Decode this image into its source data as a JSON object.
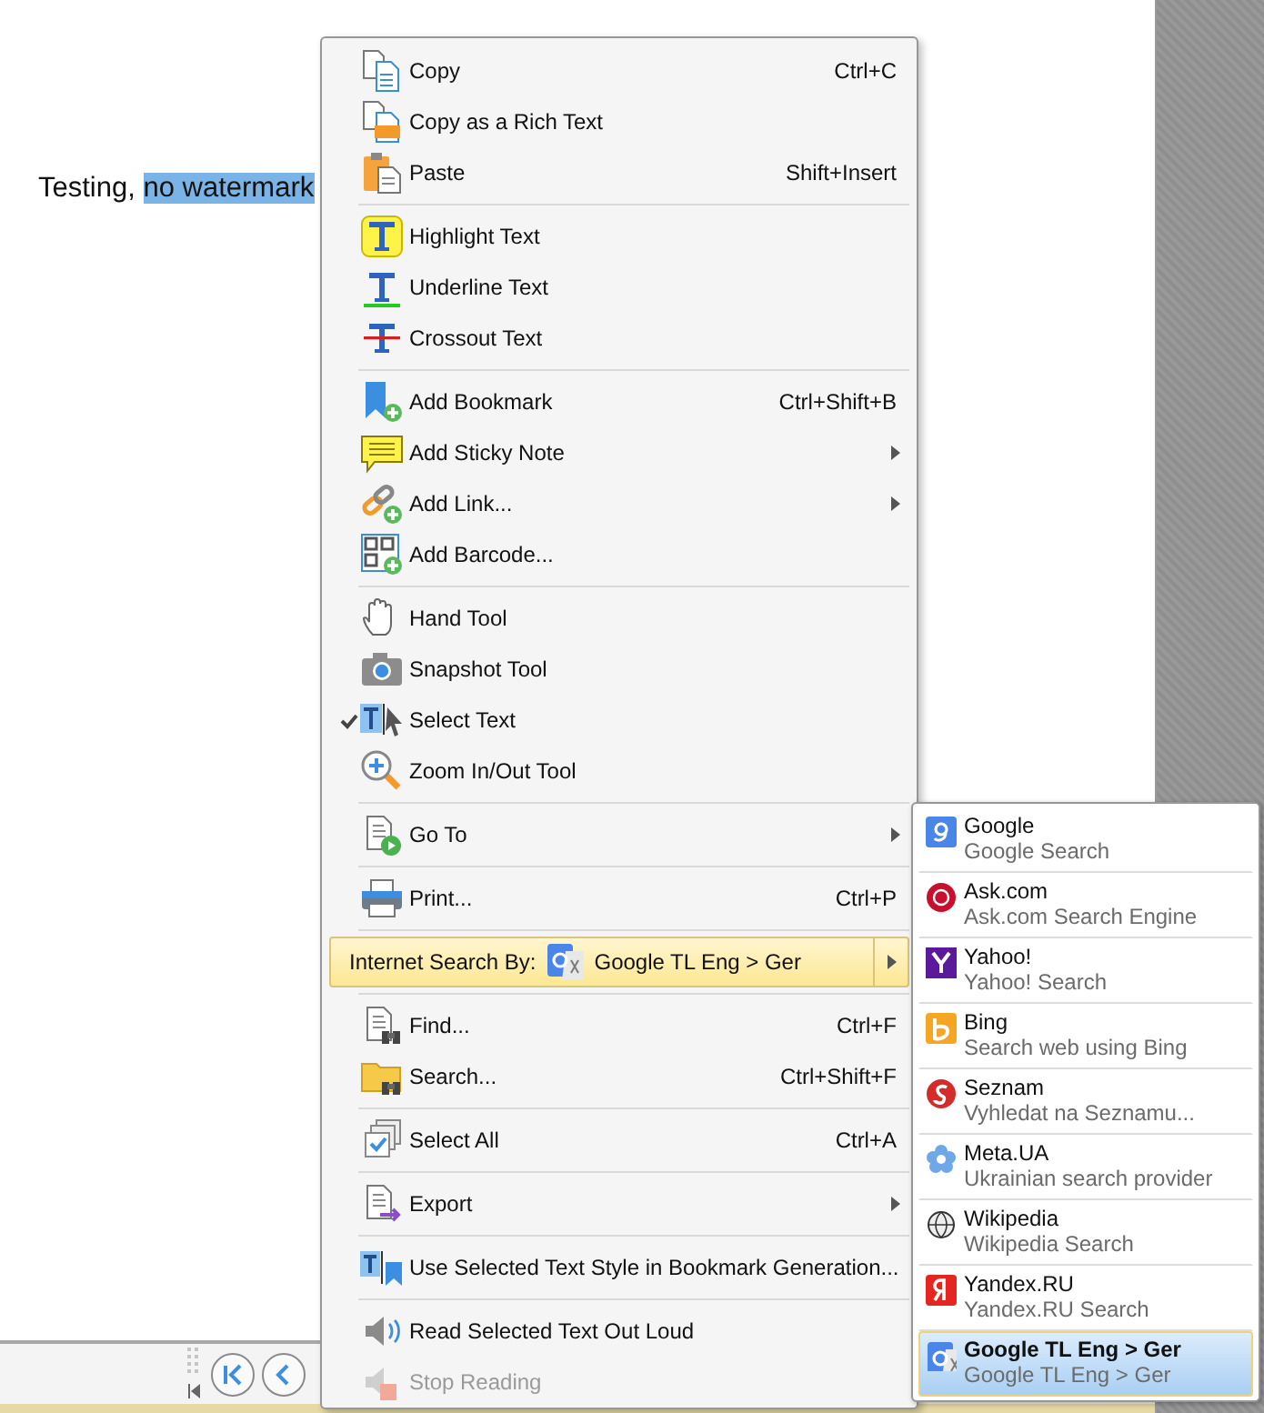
{
  "document": {
    "parts": [
      {
        "text": "Testing, ",
        "selected": false
      },
      {
        "text": "no watermark",
        "selected": true
      }
    ]
  },
  "toolbar": {
    "buttons": [
      {
        "kind": "first-page"
      },
      {
        "kind": "previous-page"
      }
    ]
  },
  "context_menu": {
    "groups": [
      [
        {
          "label": "Copy",
          "shortcut": "Ctrl+C",
          "submenu": false,
          "checked": false,
          "disabled": false,
          "selected": false
        },
        {
          "label": "Copy as a Rich Text",
          "submenu": false,
          "checked": false,
          "disabled": false,
          "selected": false
        },
        {
          "label": "Paste",
          "shortcut": "Shift+Insert",
          "submenu": false,
          "checked": false,
          "disabled": false,
          "selected": false
        }
      ],
      [
        {
          "label": "Highlight Text",
          "submenu": false,
          "checked": false,
          "disabled": false,
          "selected": false
        },
        {
          "label": "Underline Text",
          "submenu": false,
          "checked": false,
          "disabled": false,
          "selected": false
        },
        {
          "label": "Crossout Text",
          "submenu": false,
          "checked": false,
          "disabled": false,
          "selected": false
        }
      ],
      [
        {
          "label": "Add Bookmark",
          "shortcut": "Ctrl+Shift+B",
          "submenu": false,
          "checked": false,
          "disabled": false,
          "selected": false
        },
        {
          "label": "Add Sticky Note",
          "submenu": true,
          "checked": false,
          "disabled": false,
          "selected": false
        },
        {
          "label": "Add Link...",
          "submenu": true,
          "checked": false,
          "disabled": false,
          "selected": false
        },
        {
          "label": "Add Barcode...",
          "submenu": false,
          "checked": false,
          "disabled": false,
          "selected": false
        }
      ],
      [
        {
          "label": "Hand Tool",
          "submenu": false,
          "checked": false,
          "disabled": false,
          "selected": false
        },
        {
          "label": "Snapshot Tool",
          "submenu": false,
          "checked": false,
          "disabled": false,
          "selected": false
        },
        {
          "label": "Select Text",
          "submenu": false,
          "checked": true,
          "disabled": false,
          "selected": false
        },
        {
          "label": "Zoom In/Out Tool",
          "submenu": false,
          "checked": false,
          "disabled": false,
          "selected": false
        }
      ],
      [
        {
          "label": "Go To",
          "submenu": true,
          "checked": false,
          "disabled": false,
          "selected": false
        }
      ],
      [
        {
          "label": "Print...",
          "shortcut": "Ctrl+P",
          "submenu": false,
          "checked": false,
          "disabled": false,
          "selected": false
        }
      ],
      [
        {
          "kind": "engine-picker",
          "label": "Internet Search By:",
          "value": "Google TL Eng > Ger",
          "submenu": true,
          "checked": false,
          "disabled": false,
          "selected": true
        }
      ],
      [
        {
          "label": "Find...",
          "shortcut": "Ctrl+F",
          "submenu": false,
          "checked": false,
          "disabled": false,
          "selected": false
        },
        {
          "label": "Search...",
          "shortcut": "Ctrl+Shift+F",
          "submenu": false,
          "checked": false,
          "disabled": false,
          "selected": false
        }
      ],
      [
        {
          "label": "Select All",
          "shortcut": "Ctrl+A",
          "submenu": false,
          "checked": false,
          "disabled": false,
          "selected": false
        }
      ],
      [
        {
          "label": "Export",
          "submenu": true,
          "checked": false,
          "disabled": false,
          "selected": false
        }
      ],
      [
        {
          "label": "Use Selected Text Style in Bookmark Generation...",
          "submenu": false,
          "checked": false,
          "disabled": false,
          "selected": false
        }
      ],
      [
        {
          "label": "Read Selected Text Out Loud",
          "submenu": false,
          "checked": false,
          "disabled": false,
          "selected": false
        },
        {
          "label": "Stop Reading",
          "submenu": false,
          "checked": false,
          "disabled": true,
          "selected": false
        }
      ]
    ]
  },
  "search_engines": [
    {
      "name": "Google",
      "description": "Google Search",
      "selected": false
    },
    {
      "name": "Ask.com",
      "description": "Ask.com Search Engine",
      "selected": false
    },
    {
      "name": "Yahoo!",
      "description": "Yahoo! Search",
      "selected": false
    },
    {
      "name": "Bing",
      "description": "Search web using Bing",
      "selected": false
    },
    {
      "name": "Seznam",
      "description": "Vyhledat na Seznamu...",
      "selected": false
    },
    {
      "name": "Meta.UA",
      "description": "Ukrainian search provider",
      "selected": false
    },
    {
      "name": "Wikipedia",
      "description": "Wikipedia Search",
      "selected": false
    },
    {
      "name": "Yandex.RU",
      "description": "Yandex.RU Search",
      "selected": false
    },
    {
      "name": "Google TL Eng > Ger",
      "description": "Google TL Eng > Ger",
      "selected": true
    }
  ]
}
